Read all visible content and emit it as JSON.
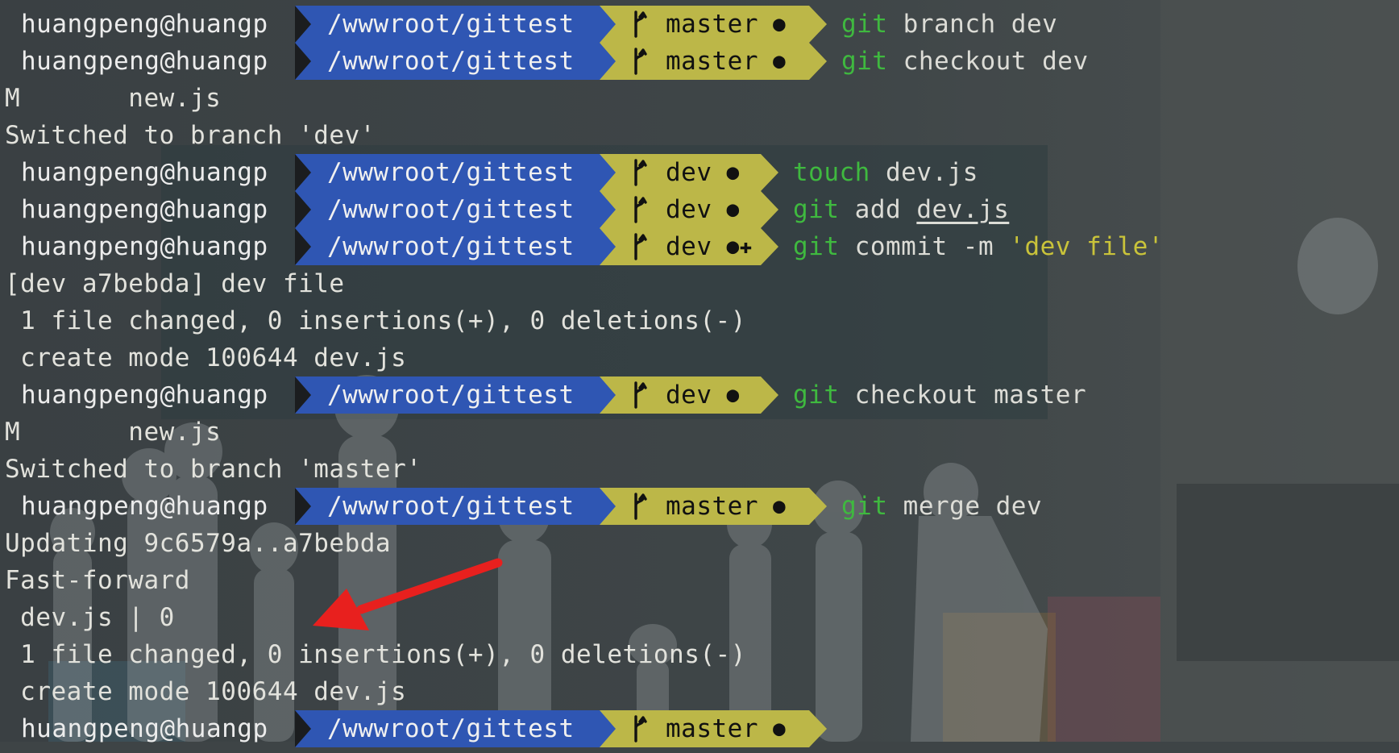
{
  "prompt": {
    "user": "huangpeng@huangp",
    "path": "/wwwroot/gittest"
  },
  "colors": {
    "path_segment": "#2f56b3",
    "branch_segment": "#bcb748",
    "command_keyword": "#3fb93f",
    "string_literal": "#c9c33a",
    "arrow": "#e8201e"
  },
  "icons": {
    "branch": "git-branch-icon",
    "annotation": "red-arrow-annotation"
  },
  "lines": [
    {
      "type": "prompt",
      "branch": "master",
      "status": "●",
      "cmd_kw": "git",
      "cmd_rest": " branch dev"
    },
    {
      "type": "prompt",
      "branch": "master",
      "status": "●",
      "cmd_kw": "git",
      "cmd_rest": " checkout dev"
    },
    {
      "type": "output",
      "text": "M       new.js"
    },
    {
      "type": "output",
      "text": "Switched to branch 'dev'"
    },
    {
      "type": "prompt",
      "branch": "dev",
      "status": "●",
      "cmd_kw": "touch",
      "cmd_rest": " dev.js"
    },
    {
      "type": "prompt",
      "branch": "dev",
      "status": "●",
      "cmd_kw": "git",
      "cmd_rest": " add ",
      "cmd_ul": "dev.js"
    },
    {
      "type": "prompt",
      "branch": "dev",
      "status": "●✚",
      "cmd_kw": "git",
      "cmd_rest": " commit -m ",
      "cmd_str": "'dev file'"
    },
    {
      "type": "output",
      "text": "[dev a7bebda] dev file"
    },
    {
      "type": "output",
      "text": " 1 file changed, 0 insertions(+), 0 deletions(-)"
    },
    {
      "type": "output",
      "text": " create mode 100644 dev.js"
    },
    {
      "type": "prompt",
      "branch": "dev",
      "status": "●",
      "cmd_kw": "git",
      "cmd_rest": " checkout master"
    },
    {
      "type": "output",
      "text": "M       new.js"
    },
    {
      "type": "output",
      "text": "Switched to branch 'master'"
    },
    {
      "type": "prompt",
      "branch": "master",
      "status": "●",
      "cmd_kw": "git",
      "cmd_rest": " merge dev"
    },
    {
      "type": "output",
      "text": "Updating 9c6579a..a7bebda"
    },
    {
      "type": "output",
      "text": "Fast-forward"
    },
    {
      "type": "output",
      "text": " dev.js | 0"
    },
    {
      "type": "output",
      "text": " 1 file changed, 0 insertions(+), 0 deletions(-)"
    },
    {
      "type": "output",
      "text": " create mode 100644 dev.js"
    },
    {
      "type": "prompt",
      "branch": "master",
      "status": "●",
      "cmd_kw": "",
      "cmd_rest": ""
    }
  ]
}
